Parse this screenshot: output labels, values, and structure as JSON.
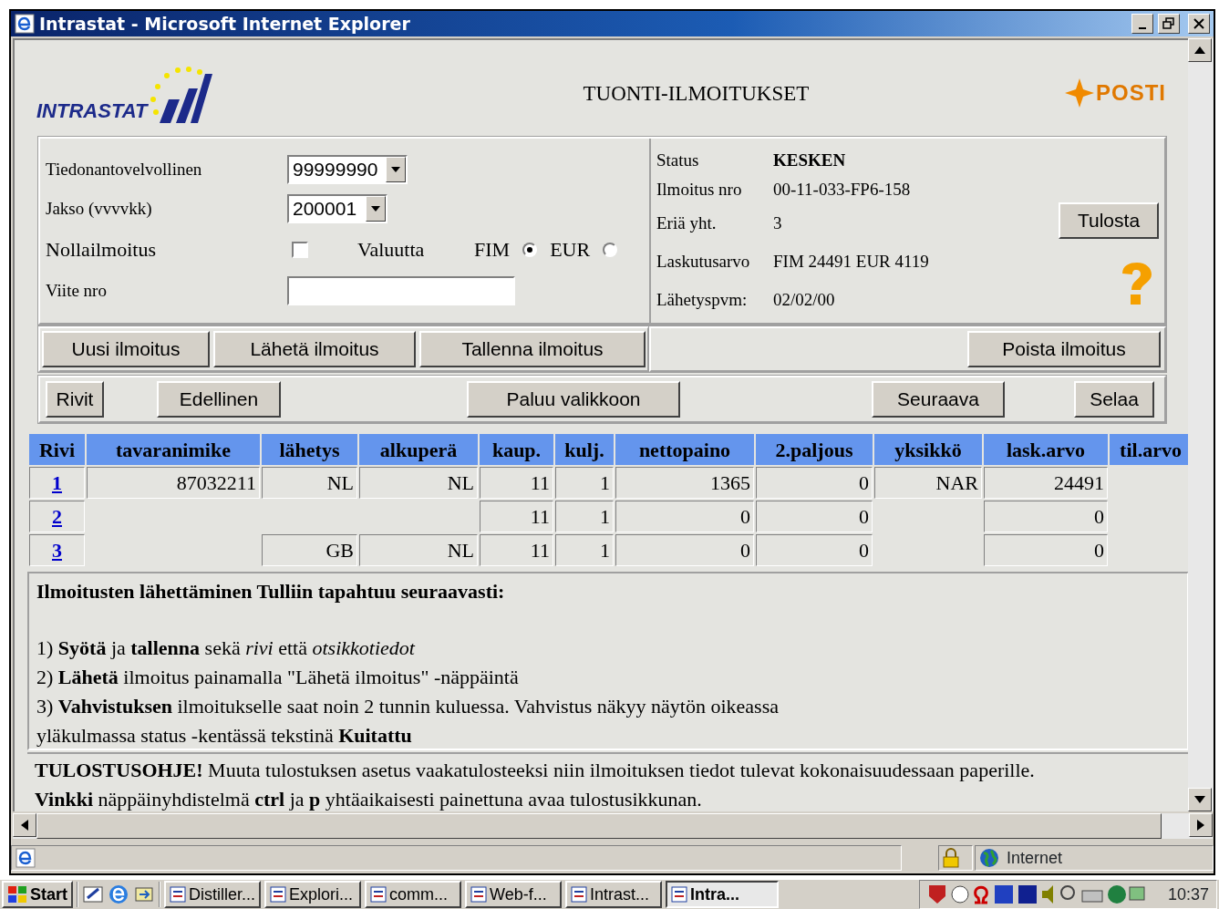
{
  "window": {
    "title": "Intrastat - Microsoft Internet Explorer"
  },
  "header": {
    "logo_text": "INTRASTAT",
    "title": "TUONTI-ILMOITUKSET",
    "brand_text": "POSTI"
  },
  "form": {
    "declarant": {
      "label": "Tiedonantovelvollinen",
      "value": "99999990"
    },
    "period": {
      "label": "Jakso (vvvvkk)",
      "value": "200001"
    },
    "nil_declaration": {
      "label": "Nollailmoitus",
      "checked": false
    },
    "currency": {
      "label": "Valuutta",
      "options": [
        {
          "label": "FIM",
          "selected": true
        },
        {
          "label": "EUR",
          "selected": false
        }
      ]
    },
    "reference": {
      "label": "Viite nro"
    }
  },
  "info": [
    {
      "label": "Status",
      "value": "KESKEN",
      "strong": true
    },
    {
      "label": "Ilmoitus nro",
      "value": "00-11-033-FP6-158",
      "strong": false
    },
    {
      "label": "Eriä yht.",
      "value": "3",
      "strong": false
    },
    {
      "label": "Laskutusarvo",
      "value": "FIM 24491 EUR 4119",
      "strong": false
    },
    {
      "label": "Lähetyspvm:",
      "value": "02/02/00",
      "strong": false
    }
  ],
  "print_button": "Tulosta",
  "action_buttons": [
    "Uusi ilmoitus",
    "Lähetä ilmoitus",
    "Tallenna ilmoitus"
  ],
  "delete_button": "Poista ilmoitus",
  "nav_buttons": [
    "Rivit",
    "Edellinen",
    "Paluu valikkoon",
    "Seuraava",
    "Selaa"
  ],
  "table": {
    "columns": [
      "Rivi",
      "tavaranimike",
      "lähetys",
      "alkuperä",
      "kaup.",
      "kulj.",
      "nettopaino",
      "2.paljous",
      "yksikkö",
      "lask.arvo",
      "til.arvo"
    ],
    "rows": [
      {
        "cells": [
          "1",
          "87032211",
          "NL",
          "NL",
          "11",
          "1",
          "1365",
          "0",
          "NAR",
          "24491",
          null
        ]
      },
      {
        "cells": [
          "2",
          null,
          null,
          null,
          "11",
          "1",
          "0",
          "0",
          null,
          "0",
          null
        ]
      },
      {
        "cells": [
          "3",
          null,
          "GB",
          "NL",
          "11",
          "1",
          "0",
          "0",
          null,
          "0",
          null
        ]
      }
    ]
  },
  "instructions": {
    "heading": "Ilmoitusten lähettäminen Tulliin tapahtuu seuraavasti:",
    "steps": [
      "1) **Syötä** ja **tallenna** sekä *rivi* että *otsikkotiedot*",
      "2) **Lähetä** ilmoitus painamalla \"Lähetä ilmoitus\" -näppäintä",
      "3) **Vahvistuksen** ilmoitukselle saat noin 2 tunnin kuluessa. Vahvistus näkyy näytön oikeassa yläkulmassa status -kentässä tekstinä **Kuitattu**"
    ]
  },
  "print_note": [
    "**TULOSTUSOHJE!** Muuta tulostuksen asetus vaakatulosteeksi niin ilmoituksen tiedot tulevat kokonaisuudessaan paperille.",
    "**Vinkki** näppäinyhdistelmä **ctrl** ja **p** yhtäaikaisesti painettuna avaa tulostusikkunan."
  ],
  "status_bar": {
    "zone": "Internet"
  },
  "taskbar": {
    "start": "Start",
    "tasks": [
      {
        "label": "Distiller...",
        "selected": false
      },
      {
        "label": "Explori...",
        "selected": false
      },
      {
        "label": "comm...",
        "selected": false
      },
      {
        "label": "Web-f...",
        "selected": false
      },
      {
        "label": "Intrast...",
        "selected": false
      },
      {
        "label": "Intra...",
        "selected": true
      }
    ],
    "clock": "10:37"
  }
}
